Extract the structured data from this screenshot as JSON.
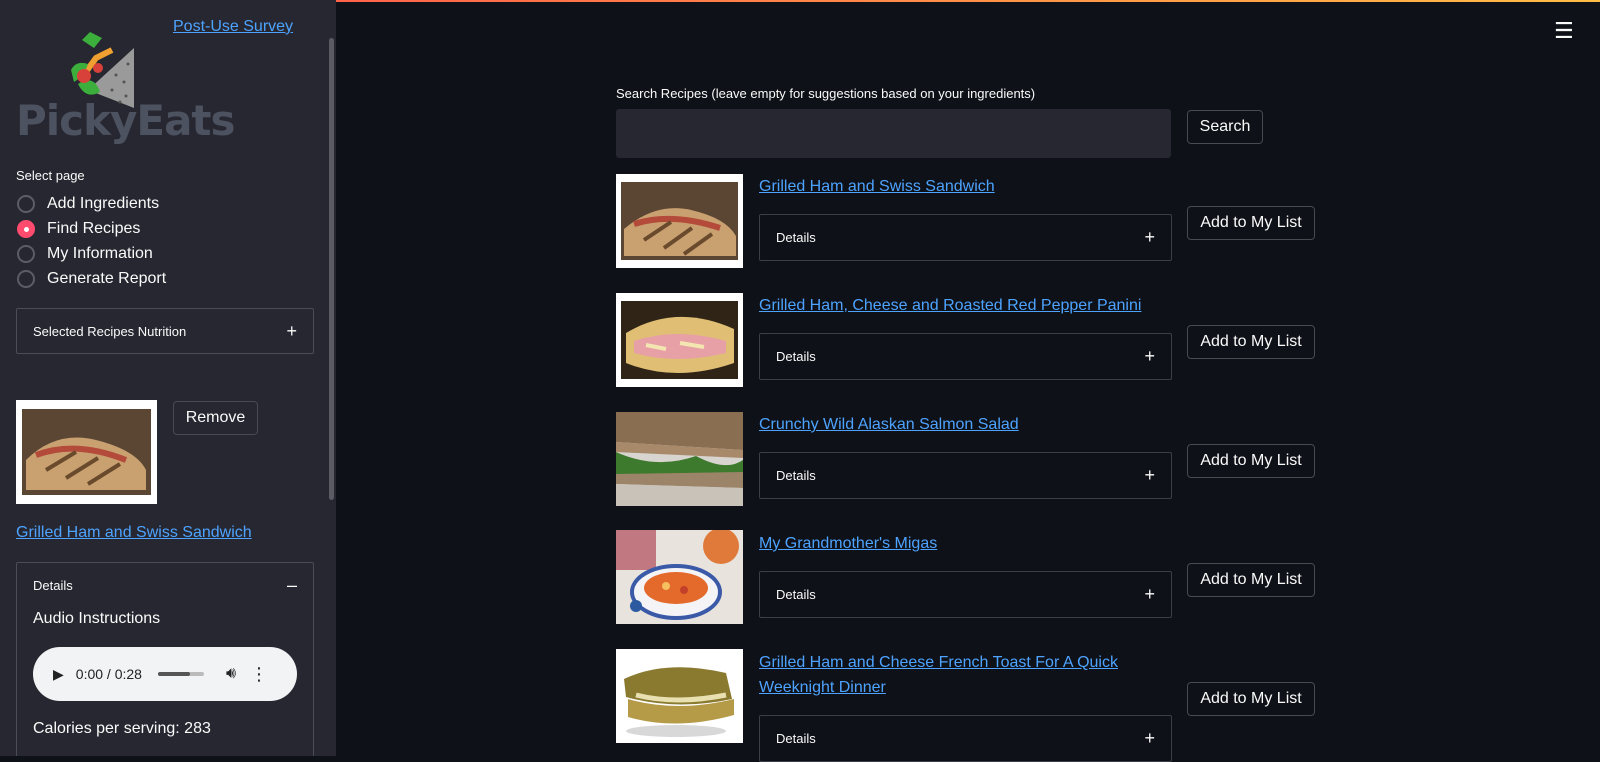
{
  "sidebar": {
    "survey_link": "Post-Use Survey",
    "logo_text": "PickyEats",
    "select_page_label": "Select page",
    "pages": [
      {
        "label": "Add Ingredients",
        "selected": false
      },
      {
        "label": "Find Recipes",
        "selected": true
      },
      {
        "label": "My Information",
        "selected": false
      },
      {
        "label": "Generate Report",
        "selected": false
      }
    ],
    "nutrition_expander": {
      "label": "Selected Recipes Nutrition",
      "sign": "+"
    },
    "selected_recipe": {
      "remove_label": "Remove",
      "title": "Grilled Ham and Swiss Sandwich",
      "details_label": "Details",
      "details_sign": "–",
      "audio_heading": "Audio Instructions",
      "audio_time": "0:00 / 0:28",
      "calories": "Calories per serving: 283"
    }
  },
  "main": {
    "search_label": "Search Recipes (leave empty for suggestions based on your ingredients)",
    "search_value": "",
    "search_button": "Search",
    "details_label": "Details",
    "details_sign": "+",
    "add_label": "Add to My List",
    "recipes": [
      {
        "title": "Grilled Ham and Swiss Sandwich"
      },
      {
        "title": "Grilled Ham, Cheese and Roasted Red Pepper Panini"
      },
      {
        "title": "Crunchy Wild Alaskan Salmon Salad"
      },
      {
        "title": "My Grandmother's Migas"
      },
      {
        "title": "Grilled Ham and Cheese French Toast For A Quick Weeknight Dinner"
      }
    ]
  },
  "icons": {
    "menu": "hamburger-menu-icon"
  },
  "colors": {
    "accent": "#ff4b6e",
    "link": "#4da3ff",
    "bg": "#0e1117",
    "sidebar": "#262730"
  }
}
